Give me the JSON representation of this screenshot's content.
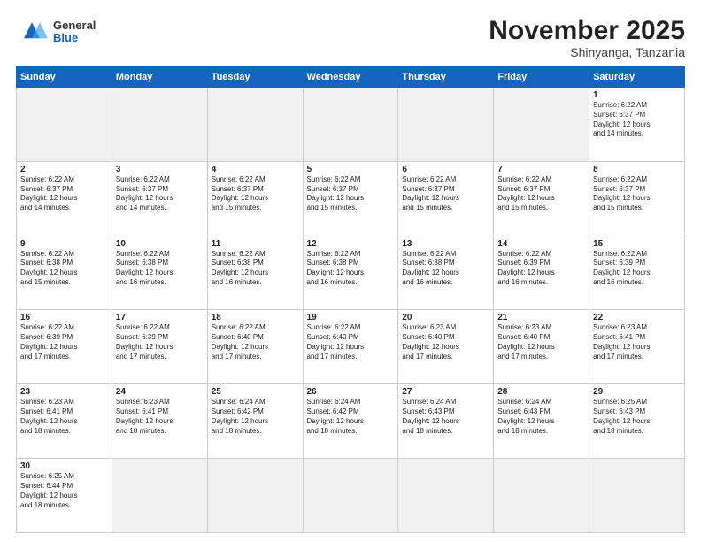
{
  "header": {
    "logo_general": "General",
    "logo_blue": "Blue",
    "month_title": "November 2025",
    "location": "Shinyanga, Tanzania"
  },
  "weekdays": [
    "Sunday",
    "Monday",
    "Tuesday",
    "Wednesday",
    "Thursday",
    "Friday",
    "Saturday"
  ],
  "weeks": [
    [
      {
        "day": "",
        "info": ""
      },
      {
        "day": "",
        "info": ""
      },
      {
        "day": "",
        "info": ""
      },
      {
        "day": "",
        "info": ""
      },
      {
        "day": "",
        "info": ""
      },
      {
        "day": "",
        "info": ""
      },
      {
        "day": "1",
        "info": "Sunrise: 6:22 AM\nSunset: 6:37 PM\nDaylight: 12 hours\nand 14 minutes."
      }
    ],
    [
      {
        "day": "2",
        "info": "Sunrise: 6:22 AM\nSunset: 6:37 PM\nDaylight: 12 hours\nand 14 minutes."
      },
      {
        "day": "3",
        "info": "Sunrise: 6:22 AM\nSunset: 6:37 PM\nDaylight: 12 hours\nand 14 minutes."
      },
      {
        "day": "4",
        "info": "Sunrise: 6:22 AM\nSunset: 6:37 PM\nDaylight: 12 hours\nand 15 minutes."
      },
      {
        "day": "5",
        "info": "Sunrise: 6:22 AM\nSunset: 6:37 PM\nDaylight: 12 hours\nand 15 minutes."
      },
      {
        "day": "6",
        "info": "Sunrise: 6:22 AM\nSunset: 6:37 PM\nDaylight: 12 hours\nand 15 minutes."
      },
      {
        "day": "7",
        "info": "Sunrise: 6:22 AM\nSunset: 6:37 PM\nDaylight: 12 hours\nand 15 minutes."
      },
      {
        "day": "8",
        "info": "Sunrise: 6:22 AM\nSunset: 6:37 PM\nDaylight: 12 hours\nand 15 minutes."
      }
    ],
    [
      {
        "day": "9",
        "info": "Sunrise: 6:22 AM\nSunset: 6:38 PM\nDaylight: 12 hours\nand 15 minutes."
      },
      {
        "day": "10",
        "info": "Sunrise: 6:22 AM\nSunset: 6:38 PM\nDaylight: 12 hours\nand 16 minutes."
      },
      {
        "day": "11",
        "info": "Sunrise: 6:22 AM\nSunset: 6:38 PM\nDaylight: 12 hours\nand 16 minutes."
      },
      {
        "day": "12",
        "info": "Sunrise: 6:22 AM\nSunset: 6:38 PM\nDaylight: 12 hours\nand 16 minutes."
      },
      {
        "day": "13",
        "info": "Sunrise: 6:22 AM\nSunset: 6:38 PM\nDaylight: 12 hours\nand 16 minutes."
      },
      {
        "day": "14",
        "info": "Sunrise: 6:22 AM\nSunset: 6:39 PM\nDaylight: 12 hours\nand 16 minutes."
      },
      {
        "day": "15",
        "info": "Sunrise: 6:22 AM\nSunset: 6:39 PM\nDaylight: 12 hours\nand 16 minutes."
      }
    ],
    [
      {
        "day": "16",
        "info": "Sunrise: 6:22 AM\nSunset: 6:39 PM\nDaylight: 12 hours\nand 17 minutes."
      },
      {
        "day": "17",
        "info": "Sunrise: 6:22 AM\nSunset: 6:39 PM\nDaylight: 12 hours\nand 17 minutes."
      },
      {
        "day": "18",
        "info": "Sunrise: 6:22 AM\nSunset: 6:40 PM\nDaylight: 12 hours\nand 17 minutes."
      },
      {
        "day": "19",
        "info": "Sunrise: 6:22 AM\nSunset: 6:40 PM\nDaylight: 12 hours\nand 17 minutes."
      },
      {
        "day": "20",
        "info": "Sunrise: 6:23 AM\nSunset: 6:40 PM\nDaylight: 12 hours\nand 17 minutes."
      },
      {
        "day": "21",
        "info": "Sunrise: 6:23 AM\nSunset: 6:40 PM\nDaylight: 12 hours\nand 17 minutes."
      },
      {
        "day": "22",
        "info": "Sunrise: 6:23 AM\nSunset: 6:41 PM\nDaylight: 12 hours\nand 17 minutes."
      }
    ],
    [
      {
        "day": "23",
        "info": "Sunrise: 6:23 AM\nSunset: 6:41 PM\nDaylight: 12 hours\nand 18 minutes."
      },
      {
        "day": "24",
        "info": "Sunrise: 6:23 AM\nSunset: 6:41 PM\nDaylight: 12 hours\nand 18 minutes."
      },
      {
        "day": "25",
        "info": "Sunrise: 6:24 AM\nSunset: 6:42 PM\nDaylight: 12 hours\nand 18 minutes."
      },
      {
        "day": "26",
        "info": "Sunrise: 6:24 AM\nSunset: 6:42 PM\nDaylight: 12 hours\nand 18 minutes."
      },
      {
        "day": "27",
        "info": "Sunrise: 6:24 AM\nSunset: 6:43 PM\nDaylight: 12 hours\nand 18 minutes."
      },
      {
        "day": "28",
        "info": "Sunrise: 6:24 AM\nSunset: 6:43 PM\nDaylight: 12 hours\nand 18 minutes."
      },
      {
        "day": "29",
        "info": "Sunrise: 6:25 AM\nSunset: 6:43 PM\nDaylight: 12 hours\nand 18 minutes."
      }
    ],
    [
      {
        "day": "30",
        "info": "Sunrise: 6:25 AM\nSunset: 6:44 PM\nDaylight: 12 hours\nand 18 minutes."
      },
      {
        "day": "",
        "info": ""
      },
      {
        "day": "",
        "info": ""
      },
      {
        "day": "",
        "info": ""
      },
      {
        "day": "",
        "info": ""
      },
      {
        "day": "",
        "info": ""
      },
      {
        "day": "",
        "info": ""
      }
    ]
  ]
}
